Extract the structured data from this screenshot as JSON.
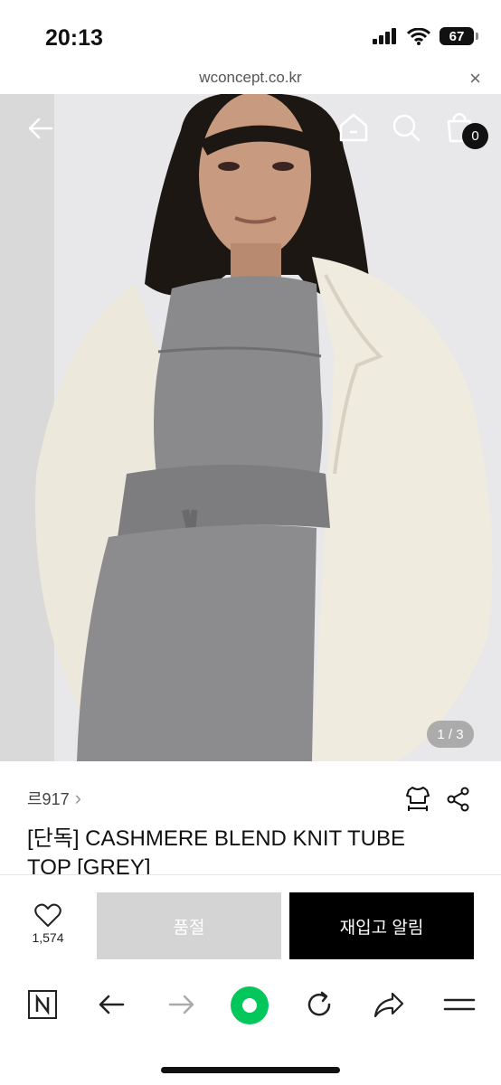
{
  "status": {
    "time": "20:13",
    "battery": "67"
  },
  "browser": {
    "url": "wconcept.co.kr",
    "close_glyph": "×"
  },
  "header": {
    "cart_count": "0",
    "icons": [
      "back-arrow-icon",
      "home-icon",
      "search-icon",
      "shopping-bag-icon"
    ]
  },
  "gallery": {
    "counter": "1 / 3"
  },
  "product": {
    "brand": "르917",
    "brand_chevron": "›",
    "title": "[단독] CASHMERE BLEND KNIT TUBE TOP [GREY]"
  },
  "actions": {
    "like_count": "1,574",
    "soldout_label": "품절",
    "restock_label": "재입고 알림"
  },
  "toolbar": {
    "icons": [
      "naver-icon",
      "back-icon",
      "forward-icon",
      "green-dot-icon",
      "refresh-icon",
      "share-icon",
      "menu-icon"
    ]
  },
  "colors": {
    "accent_green": "#03c75a",
    "soldout_bg": "#d4d4d4",
    "primary_button": "#000000"
  }
}
